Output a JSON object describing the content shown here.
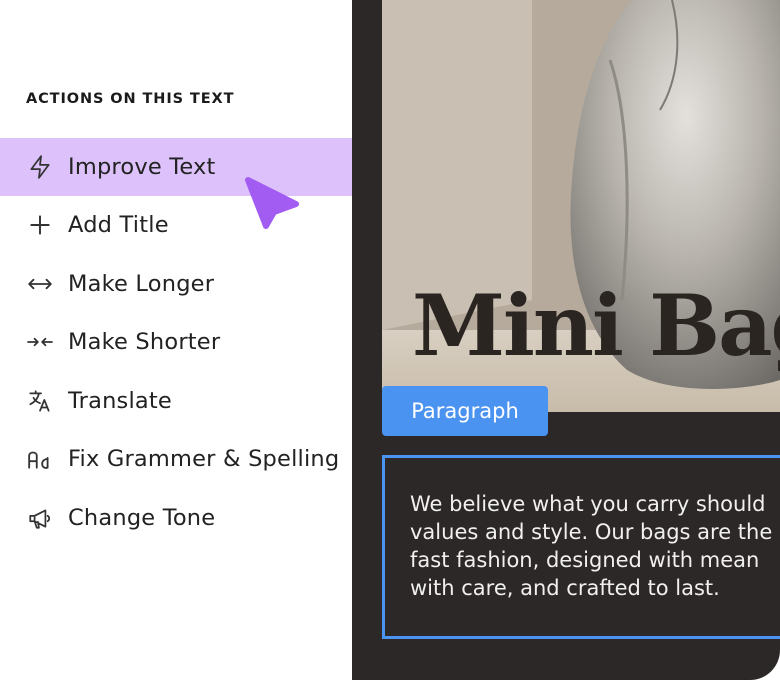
{
  "menu": {
    "heading": "ACTIONS ON THIS TEXT",
    "items": [
      {
        "label": "Improve Text",
        "icon": "lightning-icon",
        "active": true
      },
      {
        "label": "Add Title",
        "icon": "plus-icon"
      },
      {
        "label": "Make Longer",
        "icon": "arrows-horizontal-icon"
      },
      {
        "label": "Make Shorter",
        "icon": "arrows-inward-icon"
      },
      {
        "label": "Translate",
        "icon": "translate-icon"
      },
      {
        "label": "Fix Grammer & Spelling",
        "icon": "font-aa-icon"
      },
      {
        "label": "Change Tone",
        "icon": "megaphone-icon"
      }
    ]
  },
  "canvas": {
    "heading": "Mini Bags",
    "tag": "Paragraph",
    "paragraph_lines": [
      "We believe what you carry should",
      "values and style. Our bags are the",
      "fast fashion, designed with mean",
      "with care, and crafted to last."
    ]
  },
  "colors": {
    "active_item": "#dcc1fb",
    "cursor": "#a35cf2",
    "selection": "#4b93f0",
    "canvas_bg": "#2b2827"
  }
}
